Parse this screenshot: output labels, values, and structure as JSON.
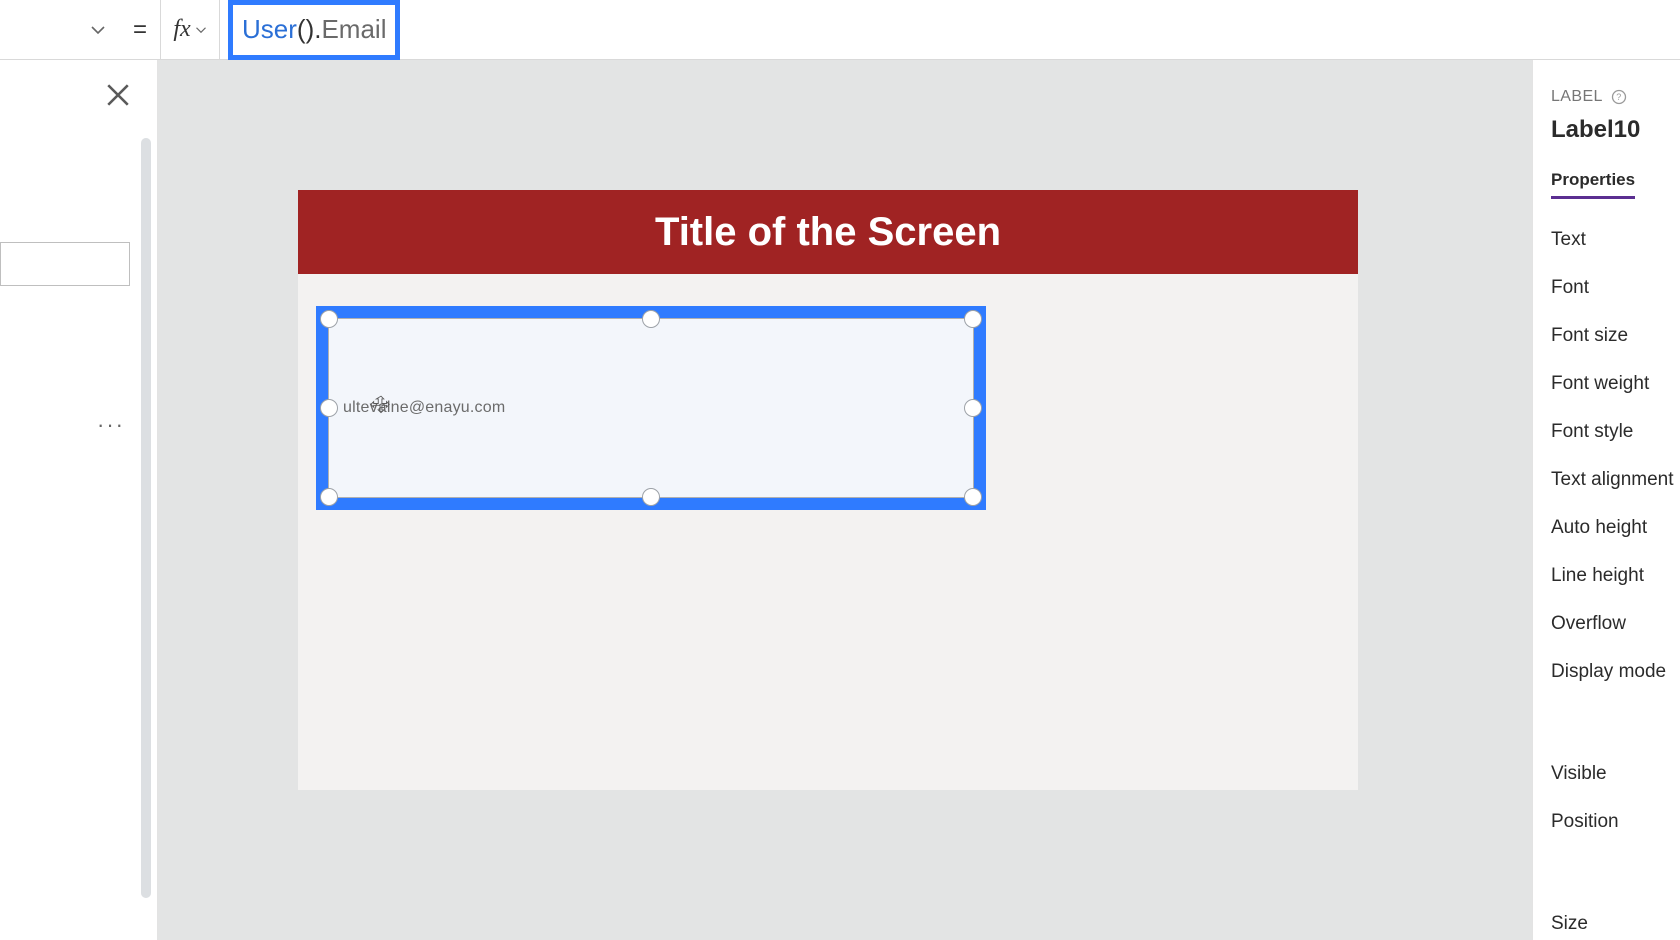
{
  "formula": {
    "fn": "User",
    "punc1": "().",
    "prop": "Email"
  },
  "leftPanel": {
    "more": "···"
  },
  "screen": {
    "title": "Title of the Screen",
    "selectedLabelText": "ultevalne@enayu.com"
  },
  "rightPanel": {
    "typeLabel": "LABEL",
    "controlName": "Label10",
    "tab": "Properties",
    "propsA": [
      "Text",
      "Font",
      "Font size",
      "Font weight",
      "Font style",
      "Text alignment",
      "Auto height",
      "Line height",
      "Overflow",
      "Display mode"
    ],
    "propsB": [
      "Visible",
      "Position"
    ],
    "propsC": [
      "Size"
    ]
  }
}
